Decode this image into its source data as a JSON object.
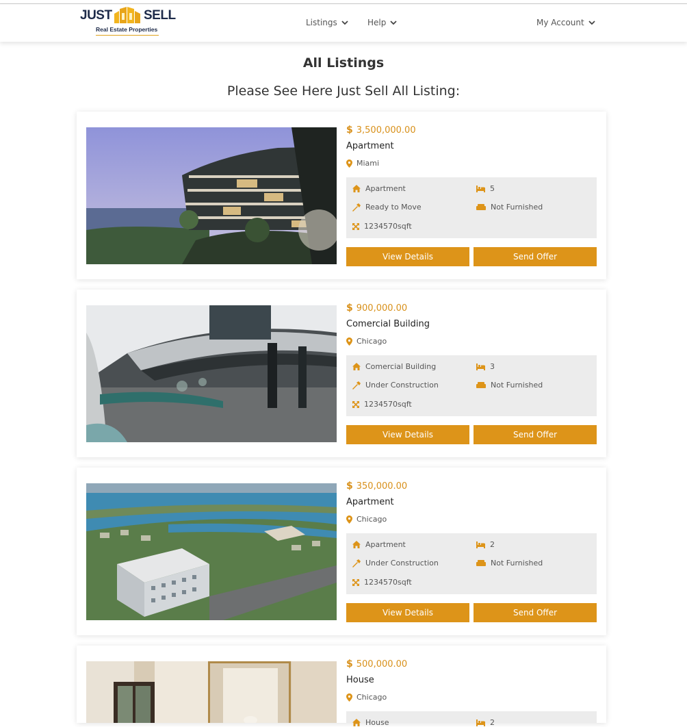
{
  "header": {
    "logo": {
      "word_left": "JUST",
      "word_right": "SELL",
      "tagline": "Real Estate Properties"
    },
    "nav": [
      {
        "label": "Listings"
      },
      {
        "label": "Help"
      }
    ],
    "account_label": "My Account"
  },
  "main": {
    "title": "All Listings",
    "subtitle": "Please See Here Just Sell All Listing:"
  },
  "theme": {
    "accent": "#dd9419",
    "brand_navy": "#1e2b4a",
    "spec_bg": "#ececec"
  },
  "listings": [
    {
      "price": "3,500,000.00",
      "title": "Apartment",
      "location": "Miami",
      "type": "Apartment",
      "bedrooms": "5",
      "status": "Ready to Move",
      "furnishing": "Not Furnished",
      "area": "1234570sqft",
      "view_label": "View Details",
      "offer_label": "Send Offer",
      "image": "modern-waterfront-apartment-photo"
    },
    {
      "price": "900,000.00",
      "title": "Comercial Building",
      "location": "Chicago",
      "type": "Comercial Building",
      "bedrooms": "3",
      "status": "Under Construction",
      "furnishing": "Not Furnished",
      "area": "1234570sqft",
      "view_label": "View Details",
      "offer_label": "Send Offer",
      "image": "commercial-building-entrance-photo"
    },
    {
      "price": "350,000.00",
      "title": "Apartment",
      "location": "Chicago",
      "type": "Apartment",
      "bedrooms": "2",
      "status": "Under Construction",
      "furnishing": "Not Furnished",
      "area": "1234570sqft",
      "view_label": "View Details",
      "offer_label": "Send Offer",
      "image": "aerial-waterfront-apartment-photo"
    },
    {
      "price": "500,000.00",
      "title": "House",
      "location": "Chicago",
      "type": "House",
      "bedrooms": "2",
      "image": "house-bedroom-interior-photo"
    }
  ]
}
